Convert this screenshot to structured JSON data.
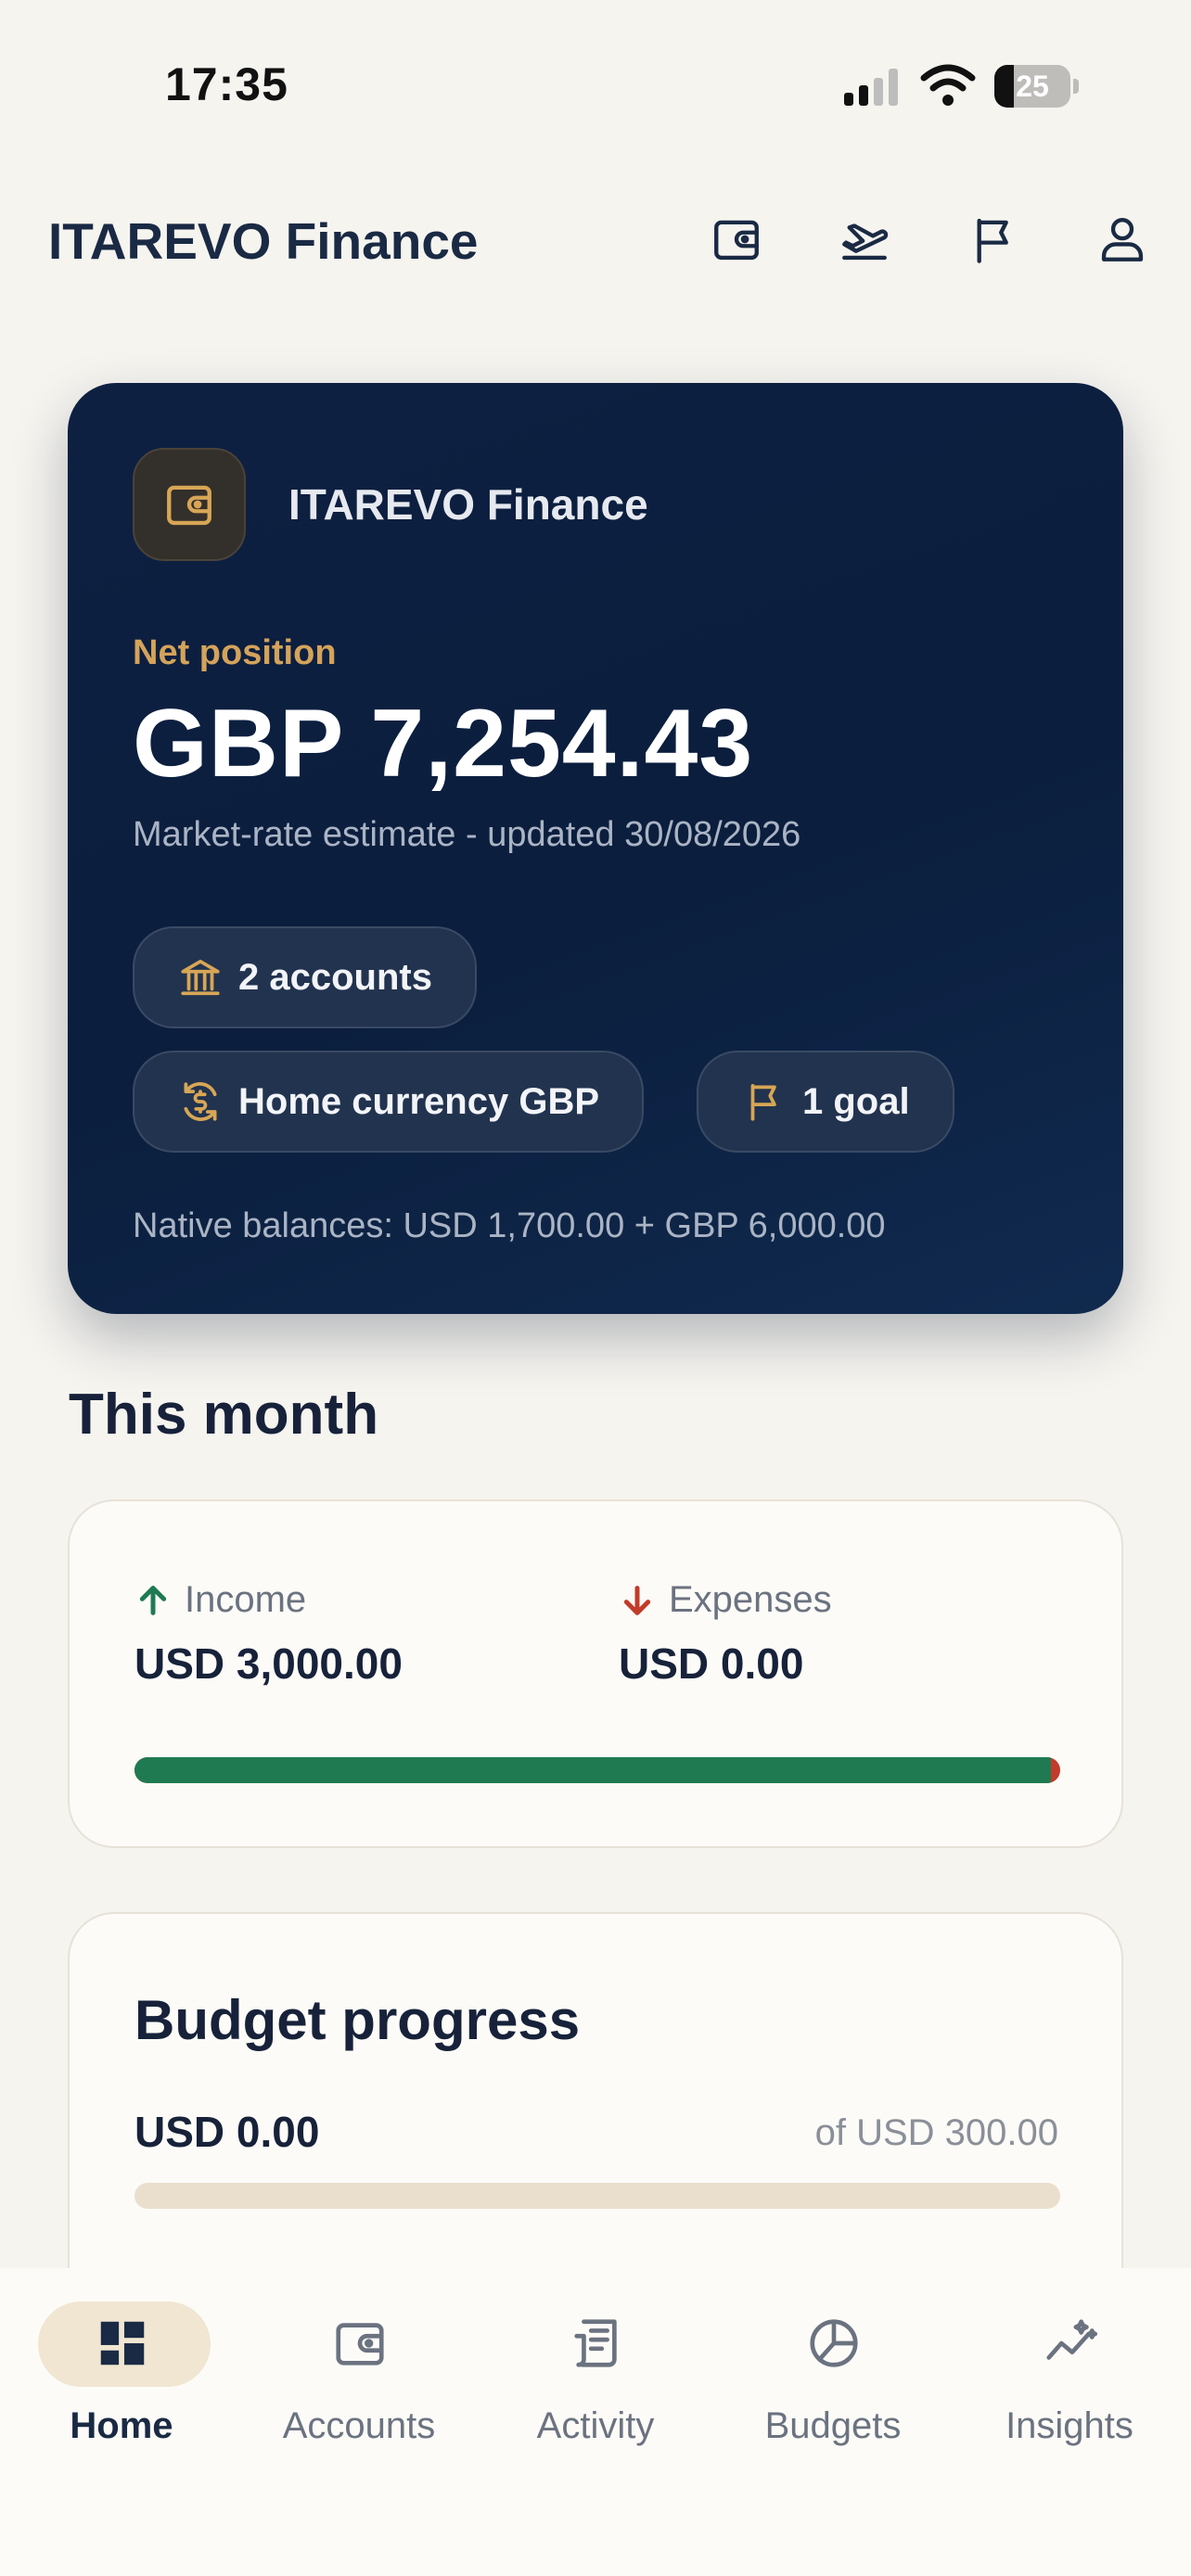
{
  "status_bar": {
    "time": "17:35",
    "battery": "25",
    "battery_level": 0.25
  },
  "header": {
    "title": "ITAREVO Finance",
    "icons": [
      "wallet-icon",
      "plane-departure-icon",
      "flag-icon",
      "user-icon"
    ]
  },
  "hero": {
    "brand": "ITAREVO Finance",
    "net_label": "Net position",
    "net_value": "GBP 7,254.43",
    "subtitle": "Market-rate estimate - updated 30/08/2026",
    "chips": {
      "accounts": "2 accounts",
      "currency": "Home currency GBP",
      "goals": "1 goal"
    },
    "native_balances": "Native balances: USD 1,700.00 + GBP 6,000.00"
  },
  "this_month": {
    "title": "This month",
    "income_label": "Income",
    "income_value": "USD 3,000.00",
    "expenses_label": "Expenses",
    "expenses_value": "USD 0.00",
    "income_share": 0.99
  },
  "budget": {
    "title": "Budget progress",
    "spent": "USD 0.00",
    "limit": "of USD 300.00",
    "progress": 0.0
  },
  "nav": {
    "items": [
      {
        "label": "Home",
        "icon": "dashboard-icon",
        "active": true
      },
      {
        "label": "Accounts",
        "icon": "wallet-icon",
        "active": false
      },
      {
        "label": "Activity",
        "icon": "receipt-icon",
        "active": false
      },
      {
        "label": "Budgets",
        "icon": "pie-chart-icon",
        "active": false
      },
      {
        "label": "Insights",
        "icon": "sparkle-trend-icon",
        "active": false
      }
    ]
  },
  "colors": {
    "background": "#F6F4EF",
    "hero_card": "#0B1E3D",
    "accent_gold": "#D4A35A",
    "income_green": "#1F7A52",
    "expense_red": "#C23B2B",
    "text_dark": "#17223A"
  }
}
